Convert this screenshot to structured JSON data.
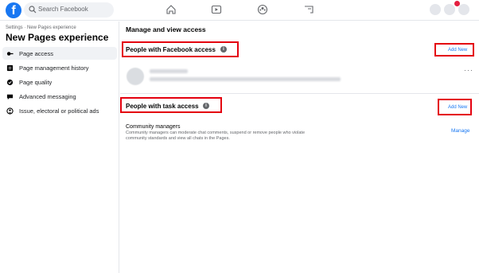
{
  "topbar": {
    "logo": "f",
    "search_placeholder": "Search Facebook",
    "icons": [
      "home-icon",
      "watch-icon",
      "groups-icon",
      "gaming-icon"
    ]
  },
  "sidebar": {
    "breadcrumb": "Settings · New Pages experience",
    "title": "New Pages experience",
    "items": [
      {
        "label": "Page access",
        "icon": "key-icon",
        "active": true
      },
      {
        "label": "Page management history",
        "icon": "history-icon",
        "active": false
      },
      {
        "label": "Page quality",
        "icon": "quality-icon",
        "active": false
      },
      {
        "label": "Advanced messaging",
        "icon": "messaging-icon",
        "active": false
      },
      {
        "label": "Issue, electoral or political ads",
        "icon": "ads-icon",
        "active": false
      }
    ]
  },
  "main": {
    "title": "Manage and view access",
    "facebook_access": {
      "title": "People with Facebook access",
      "add_label": "Add New",
      "more_label": "···"
    },
    "task_access": {
      "title": "People with task access",
      "add_label": "Add New",
      "role_title": "Community managers",
      "role_desc": "Community managers can moderate chat comments, suspend or remove people who violate community standards and view all chats in the Pages.",
      "manage_label": "Manage"
    }
  },
  "colors": {
    "accent": "#1877f2",
    "highlight_box": "#e4000f"
  }
}
